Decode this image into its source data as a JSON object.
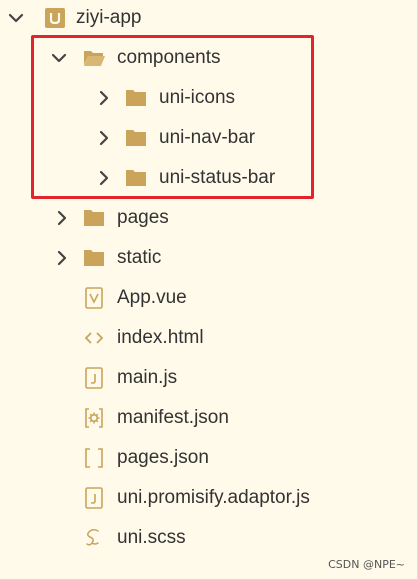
{
  "colors": {
    "background": "#fffaea",
    "folder": "#c9a45a",
    "chevron": "#555555",
    "highlight_border": "#e2242d",
    "text": "#333333"
  },
  "tree": {
    "root": {
      "label": "ziyi-app",
      "icon": "uni-app-project-icon",
      "expanded": true
    },
    "components": {
      "label": "components",
      "icon": "folder-open-icon",
      "expanded": true
    },
    "uni_icons": {
      "label": "uni-icons",
      "icon": "folder-icon",
      "expanded": false
    },
    "uni_nav_bar": {
      "label": "uni-nav-bar",
      "icon": "folder-icon",
      "expanded": false
    },
    "uni_status_bar": {
      "label": "uni-status-bar",
      "icon": "folder-icon",
      "expanded": false
    },
    "pages": {
      "label": "pages",
      "icon": "folder-icon",
      "expanded": false
    },
    "static": {
      "label": "static",
      "icon": "folder-icon",
      "expanded": false
    },
    "app_vue": {
      "label": "App.vue",
      "icon": "vue-file-icon"
    },
    "index_html": {
      "label": "index.html",
      "icon": "html-file-icon"
    },
    "main_js": {
      "label": "main.js",
      "icon": "js-file-icon"
    },
    "manifest_json": {
      "label": "manifest.json",
      "icon": "manifest-file-icon"
    },
    "pages_json": {
      "label": "pages.json",
      "icon": "json-file-icon"
    },
    "promisify_js": {
      "label": "uni.promisify.adaptor.js",
      "icon": "js-file-icon"
    },
    "uni_scss": {
      "label": "uni.scss",
      "icon": "scss-file-icon"
    }
  },
  "watermark": "CSDN @NPE~"
}
